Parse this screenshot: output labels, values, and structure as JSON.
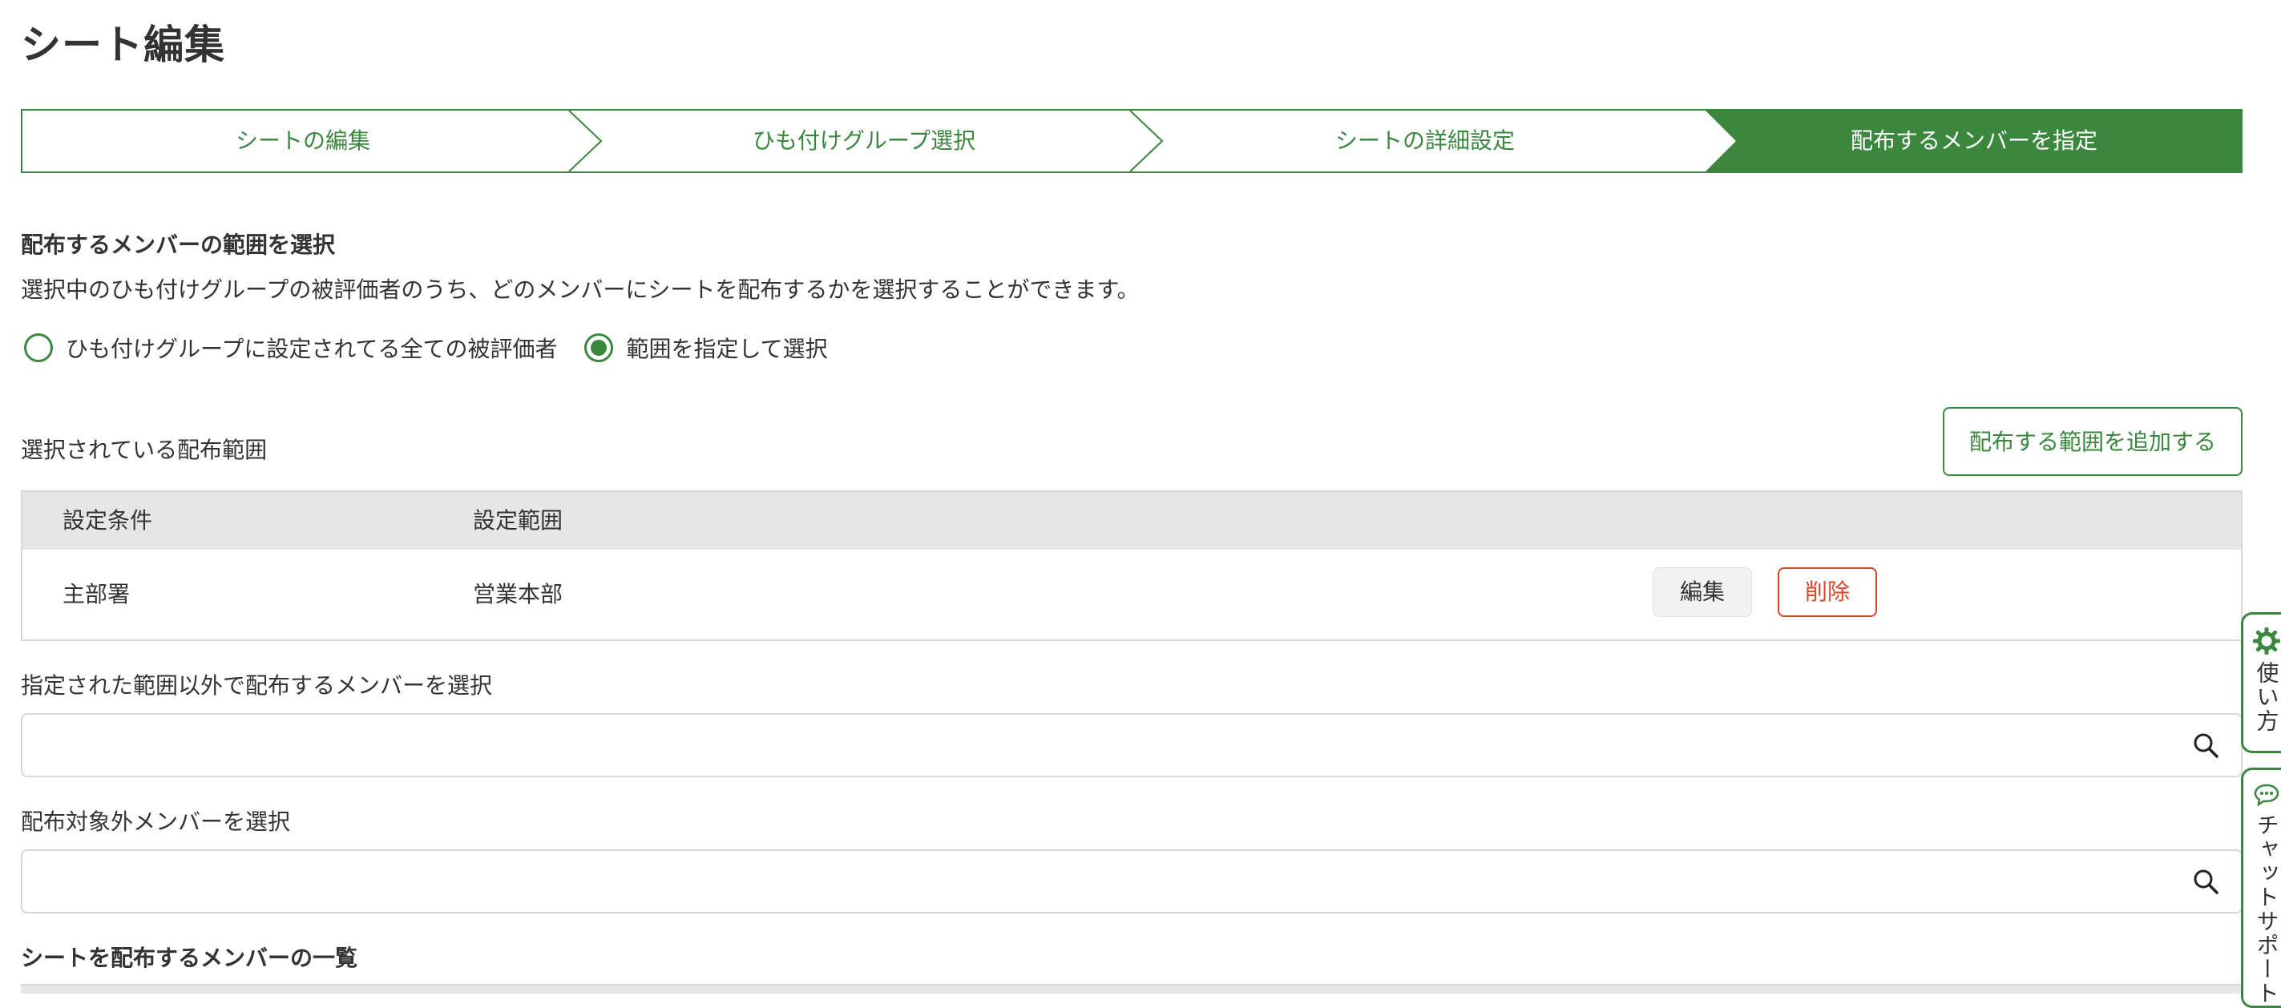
{
  "page": {
    "title": "シート編集"
  },
  "stepper": {
    "steps": [
      {
        "label": "シートの編集",
        "active": false
      },
      {
        "label": "ひも付けグループ選択",
        "active": false
      },
      {
        "label": "シートの詳細設定",
        "active": false
      },
      {
        "label": "配布するメンバーを指定",
        "active": true
      }
    ]
  },
  "range_section": {
    "title": "配布するメンバーの範囲を選択",
    "description": "選択中のひも付けグループの被評価者のうち、どのメンバーにシートを配布するかを選択することができます。",
    "options": [
      {
        "label": "ひも付けグループに設定されてる全ての被評価者",
        "checked": false
      },
      {
        "label": "範囲を指定して選択",
        "checked": true
      }
    ]
  },
  "selected_range": {
    "label": "選択されている配布範囲",
    "add_button": "配布する範囲を追加する",
    "columns": [
      "設定条件",
      "設定範囲"
    ],
    "rows": [
      {
        "condition": "主部署",
        "range": "営業本部",
        "edit": "編集",
        "delete": "削除"
      }
    ]
  },
  "extra_members": {
    "label": "指定された範囲以外で配布するメンバーを選択",
    "value": "",
    "placeholder": ""
  },
  "excluded_members": {
    "label": "配布対象外メンバーを選択",
    "value": "",
    "placeholder": ""
  },
  "member_list": {
    "title": "シートを配布するメンバーの一覧"
  },
  "side_tabs": {
    "howto": {
      "icon": "gear-icon",
      "label": "使い方"
    },
    "chat": {
      "icon": "chat-bubble-icon",
      "label": "チャットサポート"
    }
  },
  "colors": {
    "accent": "#3b873e",
    "danger": "#d9472b",
    "header_bg": "#e6e6e6"
  }
}
